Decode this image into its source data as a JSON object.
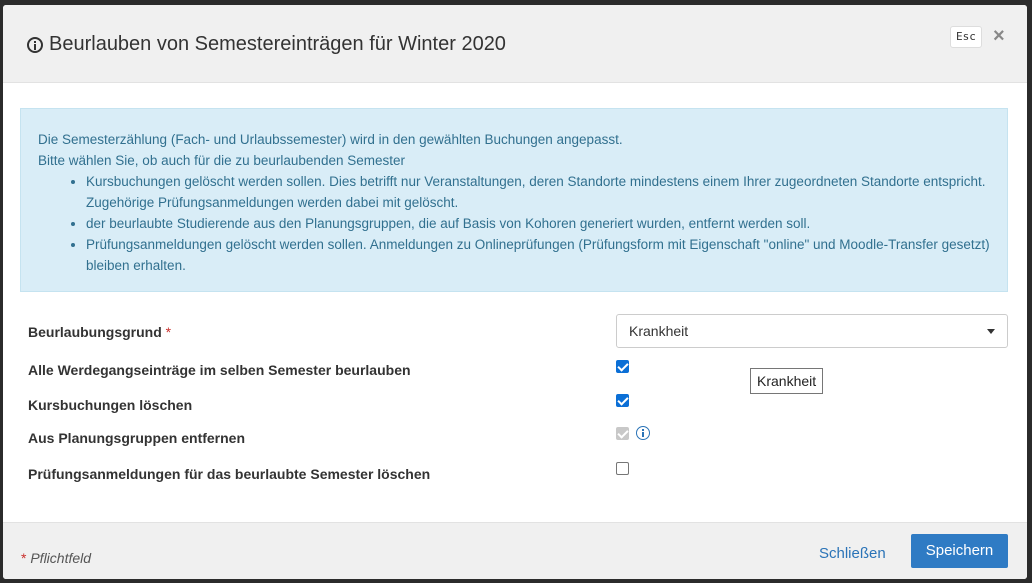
{
  "header": {
    "title": "Beurlauben von Semestereinträgen für Winter 2020",
    "esc_label": "Esc",
    "close_label": "×"
  },
  "alert": {
    "line1": "Die Semesterzählung (Fach- und Urlaubssemester) wird in den gewählten Buchungen angepasst.",
    "line2": "Bitte wählen Sie, ob auch für die zu beurlaubenden Semester",
    "bullets": [
      "Kursbuchungen gelöscht werden sollen. Dies betrifft nur Veranstaltungen, deren Standorte mindestens einem Ihrer zugeordneten Standorte entspricht. Zugehörige Prüfungsanmeldungen werden dabei mit gelöscht.",
      "der beurlaubte Studierende aus den Planungsgruppen, die auf Basis von Kohoren generiert wurden, entfernt werden soll.",
      "Prüfungsanmeldungen gelöscht werden sollen. Anmeldungen zu Onlineprüfungen (Prüfungsform mit Eigenschaft \"online\" und Moodle-Transfer gesetzt) bleiben erhalten."
    ]
  },
  "form": {
    "reason_label": "Beurlaubungsgrund",
    "required_mark": "*",
    "reason_value": "Krankheit",
    "rows": [
      {
        "label": "Alle Werdegangseinträge im selben Semester beurlauben",
        "checked": true,
        "disabled": false
      },
      {
        "label": "Kursbuchungen löschen",
        "checked": true,
        "disabled": false
      },
      {
        "label": "Aus Planungsgruppen entfernen",
        "checked": true,
        "disabled": true
      },
      {
        "label": "Prüfungsanmeldungen für das beurlaubte Semester löschen",
        "checked": false,
        "disabled": false
      }
    ],
    "tooltip": "Krankheit"
  },
  "footer": {
    "required_mark": "*",
    "required_note": "Pflichtfeld",
    "close_button": "Schließen",
    "save_button": "Speichern"
  },
  "colors": {
    "primary": "#2f7bc4",
    "alert_bg": "#d9edf7",
    "alert_text": "#31708f",
    "checkbox": "#0b6fd6",
    "required": "#c9302c"
  }
}
